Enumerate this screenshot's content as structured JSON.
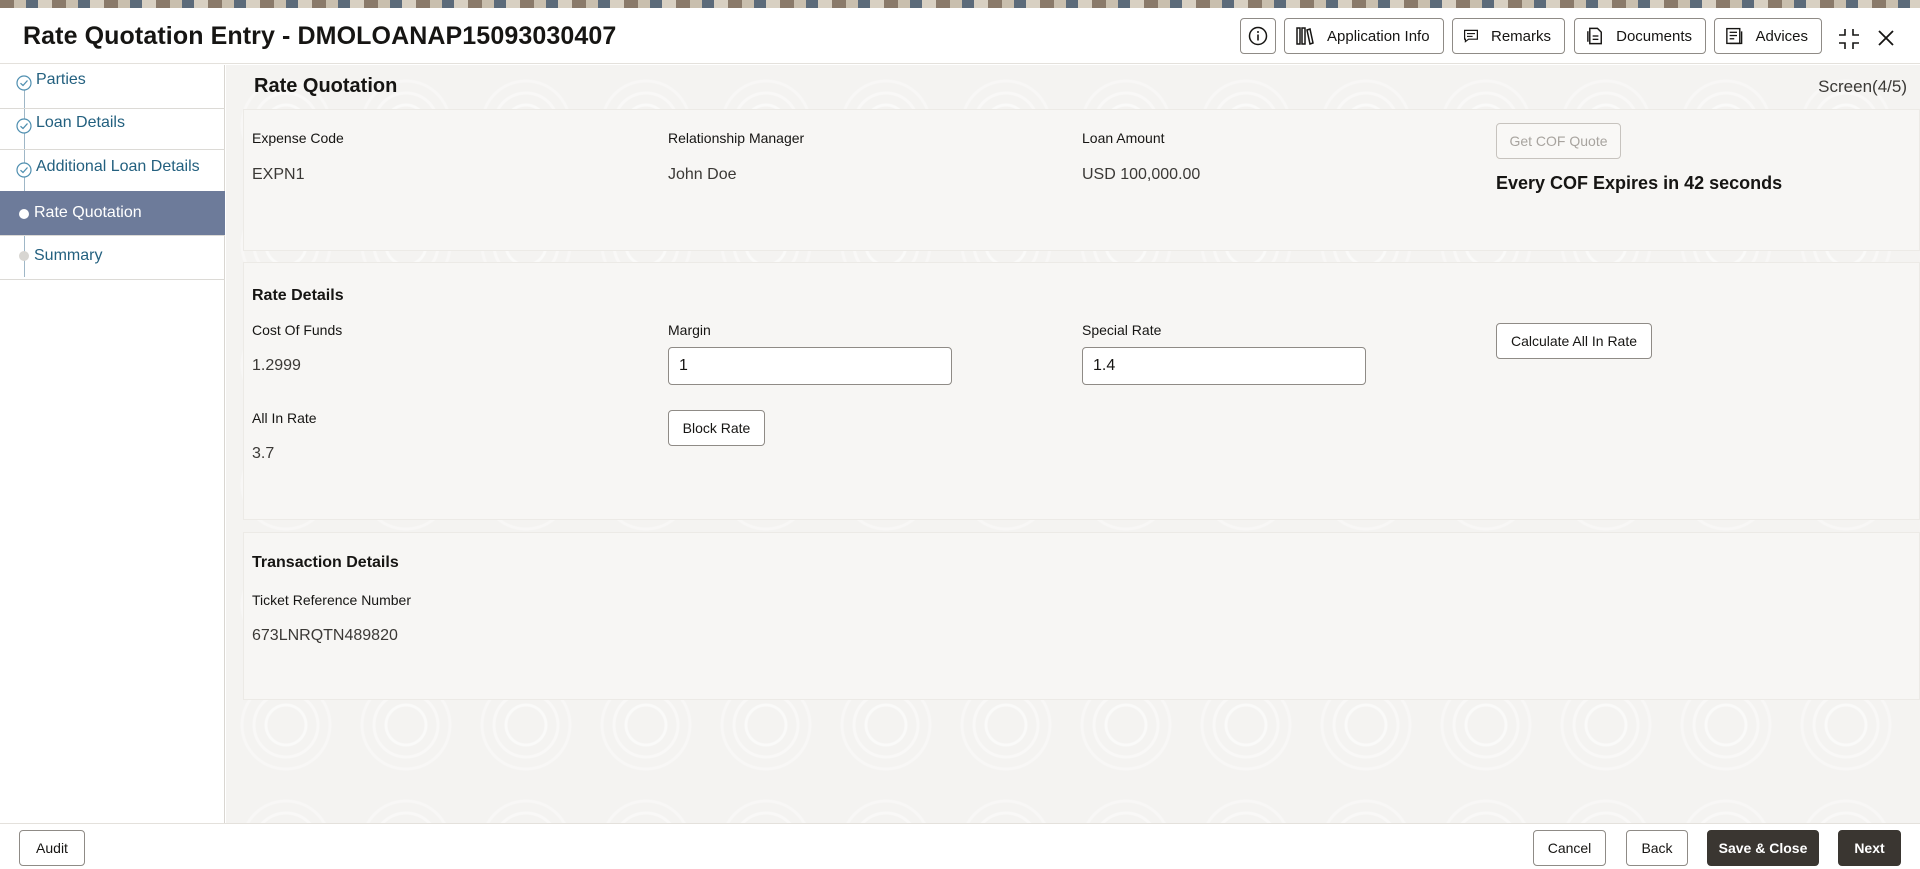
{
  "header": {
    "title": "Rate Quotation Entry - DMOLOANAP15093030407",
    "buttons": {
      "application_info": "Application Info",
      "remarks": "Remarks",
      "documents": "Documents",
      "advices": "Advices"
    },
    "icons": [
      "info-icon",
      "application-info-icon",
      "remarks-icon",
      "documents-icon",
      "advices-icon",
      "collapse-icon",
      "close-icon"
    ]
  },
  "sidebar": {
    "steps": [
      {
        "label": "Parties",
        "state": "completed"
      },
      {
        "label": "Loan Details",
        "state": "completed"
      },
      {
        "label": "Additional Loan Details",
        "state": "completed"
      },
      {
        "label": "Rate Quotation",
        "state": "active"
      },
      {
        "label": "Summary",
        "state": "pending"
      }
    ]
  },
  "main": {
    "section_title": "Rate Quotation",
    "screen_indicator": "Screen(4/5)",
    "quote": {
      "expense_code_label": "Expense Code",
      "expense_code_value": "EXPN1",
      "rm_label": "Relationship Manager",
      "rm_value": "John Doe",
      "loan_amount_label": "Loan Amount",
      "loan_amount_value": "USD 100,000.00",
      "get_cof_button": "Get COF Quote",
      "expiry_text": "Every COF Expires in 42 seconds"
    },
    "rate_details": {
      "title": "Rate Details",
      "cof_label": "Cost Of Funds",
      "cof_value": "1.2999",
      "margin_label": "Margin",
      "margin_value": "1",
      "special_rate_label": "Special Rate",
      "special_rate_value": "1.4",
      "calculate_button": "Calculate All In Rate",
      "all_in_rate_label": "All In Rate",
      "all_in_rate_value": "3.7",
      "block_rate_button": "Block Rate"
    },
    "transaction": {
      "title": "Transaction Details",
      "ticket_label": "Ticket Reference Number",
      "ticket_value": "673LNRQTN489820"
    }
  },
  "footer": {
    "audit": "Audit",
    "cancel": "Cancel",
    "back": "Back",
    "save_close": "Save & Close",
    "next": "Next"
  },
  "colors": {
    "active_step_bg": "#6d7b9a",
    "step_link": "#23607f",
    "dark_button": "#3a3631"
  }
}
